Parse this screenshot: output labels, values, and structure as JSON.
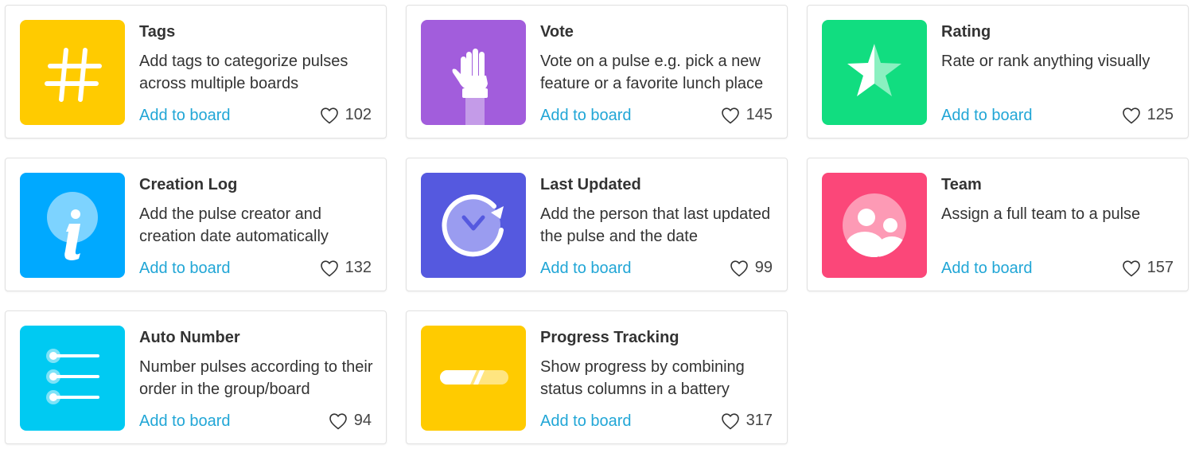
{
  "common": {
    "add_label": "Add to board"
  },
  "colors": {
    "link": "#21a6d6",
    "border": "#e1e1e1",
    "text": "#333333"
  },
  "columns": [
    {
      "key": "tags",
      "title": "Tags",
      "description": "Add tags to categorize pulses across multiple boards",
      "likes": "102",
      "icon": "hashtag-icon",
      "color": "#ffcb00"
    },
    {
      "key": "vote",
      "title": "Vote",
      "description": "Vote on a pulse e.g. pick a new feature or a favorite lunch place",
      "likes": "145",
      "icon": "raised-hand-icon",
      "color": "#a25ddc"
    },
    {
      "key": "rating",
      "title": "Rating",
      "description": "Rate or rank anything visually",
      "likes": "125",
      "icon": "star-icon",
      "color": "#11dd80"
    },
    {
      "key": "creation-log",
      "title": "Creation Log",
      "description": "Add the pulse creator and creation date automatically",
      "likes": "132",
      "icon": "info-icon",
      "color": "#00a9ff"
    },
    {
      "key": "last-updated",
      "title": "Last Updated",
      "description": "Add the person that last updated the pulse and the date",
      "likes": "99",
      "icon": "refresh-clock-icon",
      "color": "#5559df"
    },
    {
      "key": "team",
      "title": "Team",
      "description": "Assign a full team to a pulse",
      "likes": "157",
      "icon": "team-icon",
      "color": "#fb4779"
    },
    {
      "key": "auto-number",
      "title": "Auto Number",
      "description": "Number pulses according to their order in the group/board",
      "likes": "94",
      "icon": "numbered-list-icon",
      "color": "#00caf2"
    },
    {
      "key": "progress-tracking",
      "title": "Progress Tracking",
      "description": "Show progress by combining status columns in a battery",
      "likes": "317",
      "icon": "progress-bar-icon",
      "color": "#ffcb00"
    }
  ]
}
